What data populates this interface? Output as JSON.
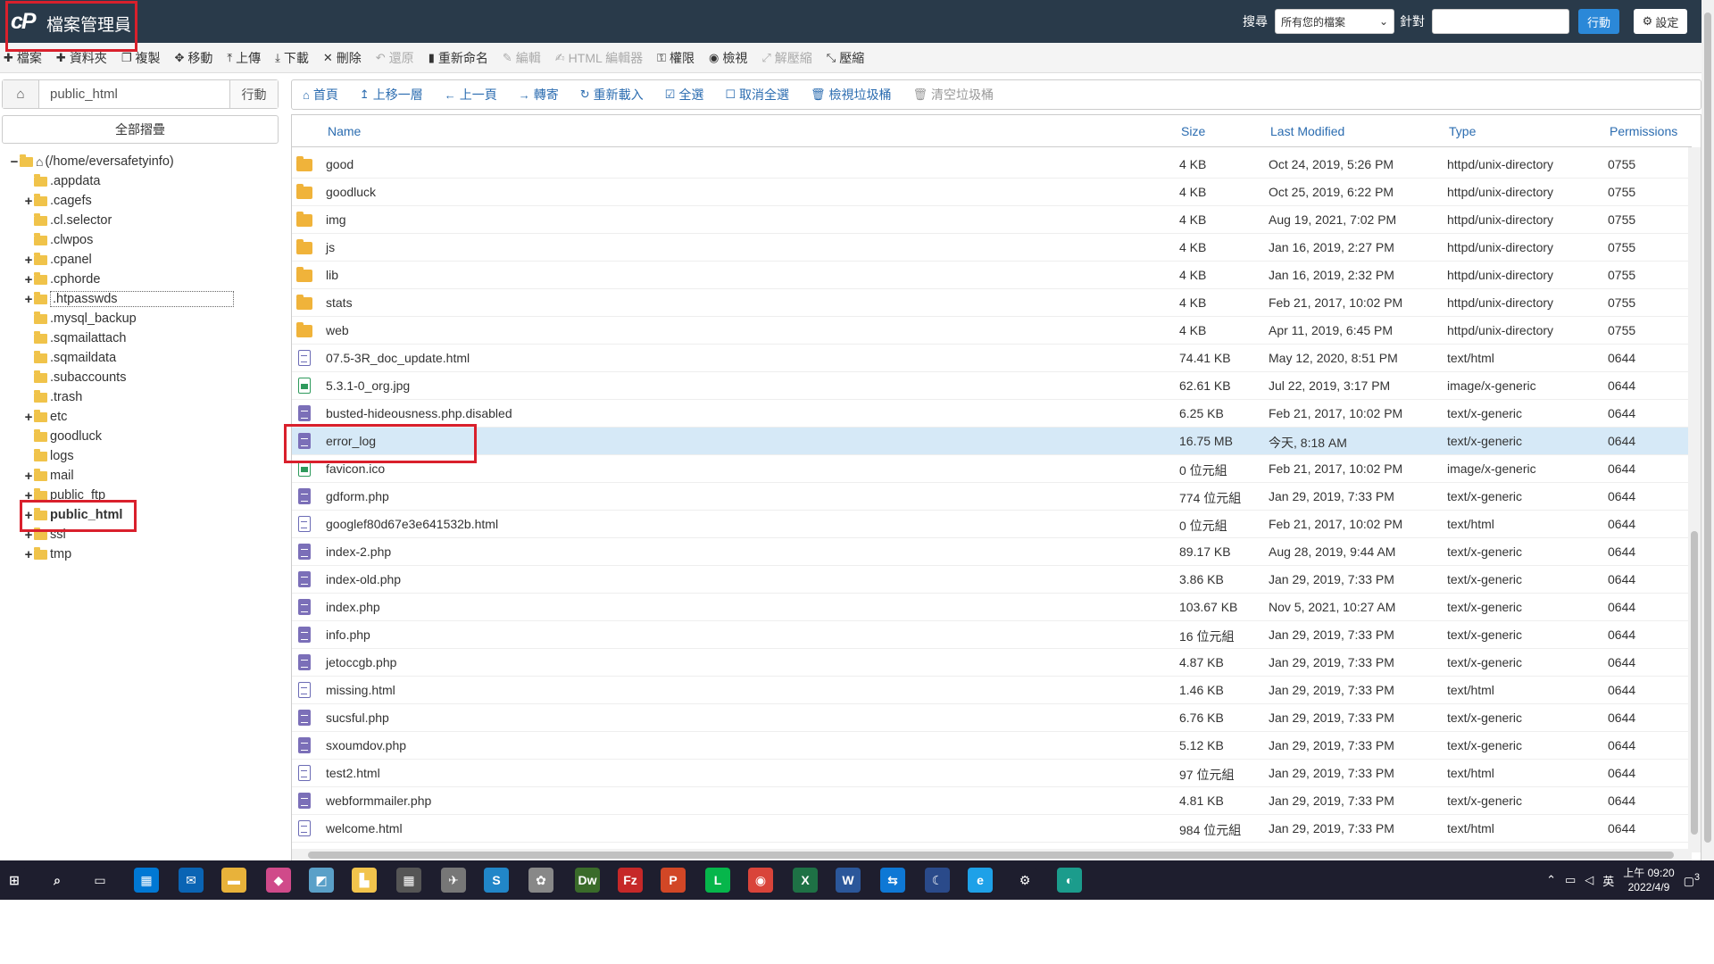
{
  "header": {
    "app_title": "檔案管理員",
    "search_label": "搜尋",
    "search_scope": "所有您的檔案",
    "for_label": "針對",
    "go_label": "行動",
    "settings_label": "設定"
  },
  "toolbar": [
    {
      "icon": "plus-icon",
      "label": "檔案",
      "disabled": false
    },
    {
      "icon": "plus-icon",
      "label": "資料夾",
      "disabled": false
    },
    {
      "icon": "copy-icon",
      "label": "複製",
      "disabled": false
    },
    {
      "icon": "move-icon",
      "label": "移動",
      "disabled": false
    },
    {
      "icon": "upload-icon",
      "label": "上傳",
      "disabled": false
    },
    {
      "icon": "download-icon",
      "label": "下載",
      "disabled": false
    },
    {
      "icon": "close-icon",
      "label": "刪除",
      "disabled": false
    },
    {
      "icon": "undo-icon",
      "label": "還原",
      "disabled": true
    },
    {
      "icon": "file-icon",
      "label": "重新命名",
      "disabled": false
    },
    {
      "icon": "pencil-icon",
      "label": "編輯",
      "disabled": true
    },
    {
      "icon": "edit-icon",
      "label": "HTML 編輯器",
      "disabled": true
    },
    {
      "icon": "key-icon",
      "label": "權限",
      "disabled": false
    },
    {
      "icon": "eye-icon",
      "label": "檢視",
      "disabled": false
    },
    {
      "icon": "expand-icon",
      "label": "解壓縮",
      "disabled": true
    },
    {
      "icon": "compress-icon",
      "label": "壓縮",
      "disabled": false
    }
  ],
  "left": {
    "path_value": "public_html",
    "path_go": "行動",
    "collapse_label": "全部摺疊",
    "tree": [
      {
        "label": "(/home/eversafetyinfo)",
        "level": 0,
        "expander": "−",
        "root": true
      },
      {
        "label": ".appdata",
        "level": 1,
        "expander": ""
      },
      {
        "label": ".cagefs",
        "level": 1,
        "expander": "+"
      },
      {
        "label": ".cl.selector",
        "level": 1,
        "expander": ""
      },
      {
        "label": ".clwpos",
        "level": 1,
        "expander": ""
      },
      {
        "label": ".cpanel",
        "level": 1,
        "expander": "+"
      },
      {
        "label": ".cphorde",
        "level": 1,
        "expander": "+"
      },
      {
        "label": ".htpasswds",
        "level": 1,
        "expander": "+",
        "focused": true
      },
      {
        "label": ".mysql_backup",
        "level": 1,
        "expander": ""
      },
      {
        "label": ".sqmailattach",
        "level": 1,
        "expander": ""
      },
      {
        "label": ".sqmaildata",
        "level": 1,
        "expander": ""
      },
      {
        "label": ".subaccounts",
        "level": 1,
        "expander": ""
      },
      {
        "label": ".trash",
        "level": 1,
        "expander": ""
      },
      {
        "label": "etc",
        "level": 1,
        "expander": "+"
      },
      {
        "label": "goodluck",
        "level": 1,
        "expander": ""
      },
      {
        "label": "logs",
        "level": 1,
        "expander": ""
      },
      {
        "label": "mail",
        "level": 1,
        "expander": "+"
      },
      {
        "label": "public_ftp",
        "level": 1,
        "expander": "+"
      },
      {
        "label": "public_html",
        "level": 1,
        "expander": "+",
        "selected": true
      },
      {
        "label": "ssl",
        "level": 1,
        "expander": "+"
      },
      {
        "label": "tmp",
        "level": 1,
        "expander": "+"
      }
    ]
  },
  "navbar": [
    {
      "icon": "home-icon",
      "label": "首頁",
      "disabled": false
    },
    {
      "icon": "up-arrow-icon",
      "label": "上移一層",
      "disabled": false
    },
    {
      "icon": "back-arrow-icon",
      "label": "上一頁",
      "disabled": false
    },
    {
      "icon": "forward-arrow-icon",
      "label": "轉寄",
      "disabled": false
    },
    {
      "icon": "reload-icon",
      "label": "重新載入",
      "disabled": false
    },
    {
      "icon": "checkbox-checked-icon",
      "label": "全選",
      "disabled": false
    },
    {
      "icon": "checkbox-empty-icon",
      "label": "取消全選",
      "disabled": false
    },
    {
      "icon": "trash-icon",
      "label": "檢視垃圾桶",
      "disabled": false
    },
    {
      "icon": "trash-icon",
      "label": "清空垃圾桶",
      "disabled": true
    }
  ],
  "table": {
    "columns": {
      "name": "Name",
      "size": "Size",
      "modified": "Last Modified",
      "type": "Type",
      "perms": "Permissions"
    },
    "rows": [
      {
        "icon": "dir",
        "name": "good",
        "size": "4 KB",
        "modified": "Oct 24, 2019, 5:26 PM",
        "type": "httpd/unix-directory",
        "perms": "0755"
      },
      {
        "icon": "dir",
        "name": "goodluck",
        "size": "4 KB",
        "modified": "Oct 25, 2019, 6:22 PM",
        "type": "httpd/unix-directory",
        "perms": "0755"
      },
      {
        "icon": "dir",
        "name": "img",
        "size": "4 KB",
        "modified": "Aug 19, 2021, 7:02 PM",
        "type": "httpd/unix-directory",
        "perms": "0755"
      },
      {
        "icon": "dir",
        "name": "js",
        "size": "4 KB",
        "modified": "Jan 16, 2019, 2:27 PM",
        "type": "httpd/unix-directory",
        "perms": "0755"
      },
      {
        "icon": "dir",
        "name": "lib",
        "size": "4 KB",
        "modified": "Jan 16, 2019, 2:32 PM",
        "type": "httpd/unix-directory",
        "perms": "0755"
      },
      {
        "icon": "dir",
        "name": "stats",
        "size": "4 KB",
        "modified": "Feb 21, 2017, 10:02 PM",
        "type": "httpd/unix-directory",
        "perms": "0755"
      },
      {
        "icon": "dir",
        "name": "web",
        "size": "4 KB",
        "modified": "Apr 11, 2019, 6:45 PM",
        "type": "httpd/unix-directory",
        "perms": "0755"
      },
      {
        "icon": "doc",
        "name": "07.5-3R_doc_update.html",
        "size": "74.41 KB",
        "modified": "May 12, 2020, 8:51 PM",
        "type": "text/html",
        "perms": "0644"
      },
      {
        "icon": "img",
        "name": "5.3.1-0_org.jpg",
        "size": "62.61 KB",
        "modified": "Jul 22, 2019, 3:17 PM",
        "type": "image/x-generic",
        "perms": "0644"
      },
      {
        "icon": "gen",
        "name": "busted-hideousness.php.disabled",
        "size": "6.25 KB",
        "modified": "Feb 21, 2017, 10:02 PM",
        "type": "text/x-generic",
        "perms": "0644"
      },
      {
        "icon": "gen",
        "name": "error_log",
        "size": "16.75 MB",
        "modified": "今天, 8:18 AM",
        "type": "text/x-generic",
        "perms": "0644",
        "selected": true
      },
      {
        "icon": "img",
        "name": "favicon.ico",
        "size": "0 位元組",
        "modified": "Feb 21, 2017, 10:02 PM",
        "type": "image/x-generic",
        "perms": "0644"
      },
      {
        "icon": "gen",
        "name": "gdform.php",
        "size": "774 位元組",
        "modified": "Jan 29, 2019, 7:33 PM",
        "type": "text/x-generic",
        "perms": "0644"
      },
      {
        "icon": "doc",
        "name": "googlef80d67e3e641532b.html",
        "size": "0 位元組",
        "modified": "Feb 21, 2017, 10:02 PM",
        "type": "text/html",
        "perms": "0644"
      },
      {
        "icon": "gen",
        "name": "index-2.php",
        "size": "89.17 KB",
        "modified": "Aug 28, 2019, 9:44 AM",
        "type": "text/x-generic",
        "perms": "0644"
      },
      {
        "icon": "gen",
        "name": "index-old.php",
        "size": "3.86 KB",
        "modified": "Jan 29, 2019, 7:33 PM",
        "type": "text/x-generic",
        "perms": "0644"
      },
      {
        "icon": "gen",
        "name": "index.php",
        "size": "103.67 KB",
        "modified": "Nov 5, 2021, 10:27 AM",
        "type": "text/x-generic",
        "perms": "0644"
      },
      {
        "icon": "gen",
        "name": "info.php",
        "size": "16 位元組",
        "modified": "Jan 29, 2019, 7:33 PM",
        "type": "text/x-generic",
        "perms": "0644"
      },
      {
        "icon": "gen",
        "name": "jetoccgb.php",
        "size": "4.87 KB",
        "modified": "Jan 29, 2019, 7:33 PM",
        "type": "text/x-generic",
        "perms": "0644"
      },
      {
        "icon": "doc",
        "name": "missing.html",
        "size": "1.46 KB",
        "modified": "Jan 29, 2019, 7:33 PM",
        "type": "text/html",
        "perms": "0644"
      },
      {
        "icon": "gen",
        "name": "sucsful.php",
        "size": "6.76 KB",
        "modified": "Jan 29, 2019, 7:33 PM",
        "type": "text/x-generic",
        "perms": "0644"
      },
      {
        "icon": "gen",
        "name": "sxoumdov.php",
        "size": "5.12 KB",
        "modified": "Jan 29, 2019, 7:33 PM",
        "type": "text/x-generic",
        "perms": "0644"
      },
      {
        "icon": "doc",
        "name": "test2.html",
        "size": "97 位元組",
        "modified": "Jan 29, 2019, 7:33 PM",
        "type": "text/html",
        "perms": "0644"
      },
      {
        "icon": "gen",
        "name": "webformmailer.php",
        "size": "4.81 KB",
        "modified": "Jan 29, 2019, 7:33 PM",
        "type": "text/x-generic",
        "perms": "0644"
      },
      {
        "icon": "doc",
        "name": "welcome.html",
        "size": "984 位元組",
        "modified": "Jan 29, 2019, 7:33 PM",
        "type": "text/html",
        "perms": "0644"
      }
    ]
  },
  "taskbar": {
    "apps": [
      {
        "name": "start-icon",
        "glyph": "⊞",
        "color": "#1e1e2e"
      },
      {
        "name": "search-icon",
        "glyph": "⌕",
        "color": "#1e1e2e"
      },
      {
        "name": "task-view-icon",
        "glyph": "▭",
        "color": "#1e1e2e"
      },
      {
        "name": "store-icon",
        "glyph": "▦",
        "color": "#0078d4"
      },
      {
        "name": "mail-icon",
        "glyph": "✉",
        "color": "#0a64b4"
      },
      {
        "name": "explorer-icon",
        "glyph": "▬",
        "color": "#e8b23a"
      },
      {
        "name": "paint-icon",
        "glyph": "◆",
        "color": "#d04a8a"
      },
      {
        "name": "app-icon",
        "glyph": "◩",
        "color": "#5aa0c8"
      },
      {
        "name": "notes-icon",
        "glyph": "▙",
        "color": "#f2c44c"
      },
      {
        "name": "calculator-icon",
        "glyph": "▦",
        "color": "#555555"
      },
      {
        "name": "app-icon-2",
        "glyph": "✈",
        "color": "#777777"
      },
      {
        "name": "skype-icon",
        "glyph": "S",
        "color": "#2186c8"
      },
      {
        "name": "app-icon-3",
        "glyph": "✿",
        "color": "#888888"
      },
      {
        "name": "dreamweaver-icon",
        "glyph": "Dw",
        "color": "#3a6b2a"
      },
      {
        "name": "filezilla-icon",
        "glyph": "Fz",
        "color": "#c62828"
      },
      {
        "name": "powerpoint-icon",
        "glyph": "P",
        "color": "#d24726"
      },
      {
        "name": "line-icon",
        "glyph": "L",
        "color": "#06b64b"
      },
      {
        "name": "chrome-icon",
        "glyph": "◉",
        "color": "#d9443a"
      },
      {
        "name": "excel-icon",
        "glyph": "X",
        "color": "#1e7145"
      },
      {
        "name": "word-icon",
        "glyph": "W",
        "color": "#2b579a"
      },
      {
        "name": "teamviewer-icon",
        "glyph": "⇆",
        "color": "#0e78d5"
      },
      {
        "name": "app-icon-4",
        "glyph": "☾",
        "color": "#2a4a8a"
      },
      {
        "name": "ie-icon",
        "glyph": "e",
        "color": "#1ea1e8"
      },
      {
        "name": "settings-icon",
        "glyph": "⚙",
        "color": "#1e1e2e"
      },
      {
        "name": "edge-icon",
        "glyph": "◐",
        "color": "#1b9c8c"
      }
    ],
    "ime": "英",
    "time": "上午 09:20",
    "date": "2022/4/9",
    "notification_count": "3"
  }
}
